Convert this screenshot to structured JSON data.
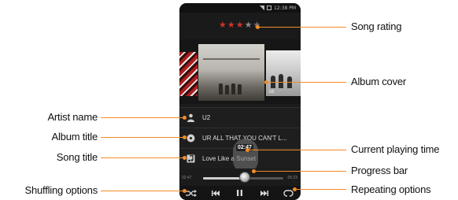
{
  "status_bar": {
    "time": "12:38 PM"
  },
  "rating": {
    "stars_filled": 3,
    "stars_half": 1,
    "stars_total": 5,
    "filled_color": "#d0332c"
  },
  "covers": {
    "right_cover_text": "U2"
  },
  "artist": {
    "name": "U2",
    "icon": "artist-icon"
  },
  "album": {
    "title": "UR ALL THAT YOU CAN'T L...",
    "icon": "album-disc-icon"
  },
  "song": {
    "title": "Love Like a Sunset",
    "icon": "music-note-icon"
  },
  "progress": {
    "elapsed": "02:47",
    "current_bubble": "02:47",
    "total": "05:23",
    "fraction": 0.52
  },
  "controls": [
    "shuffle-icon",
    "previous-icon",
    "pause-icon",
    "next-icon",
    "repeat-icon"
  ],
  "callouts": {
    "song_rating": "Song rating",
    "album_cover": "Album cover",
    "artist_name": "Artist name",
    "album_title": "Album title",
    "song_title": "Song title",
    "current_playing_time": "Current playing time",
    "progress_bar": "Progress bar",
    "shuffling_options": "Shuffling options",
    "repeating_options": "Repeating options"
  },
  "accent_color": "#f28c28"
}
